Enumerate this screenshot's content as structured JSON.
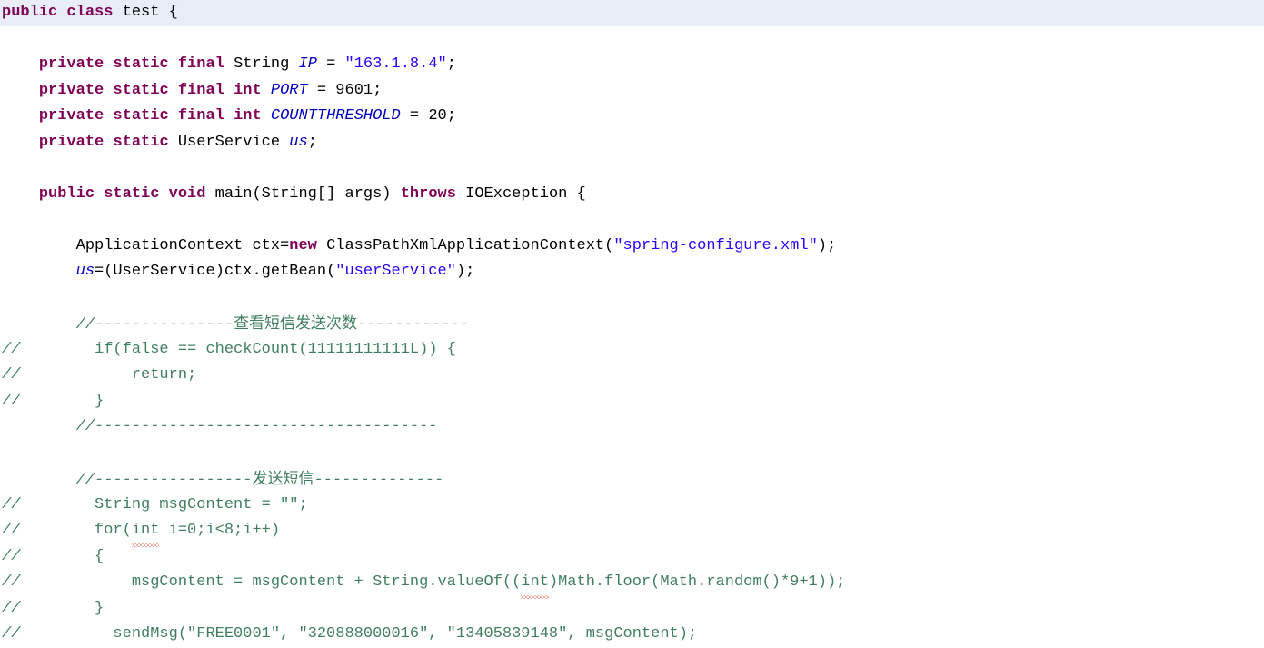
{
  "editor": {
    "language": "java",
    "class_name": "test",
    "colors": {
      "keyword": "#7f0055",
      "string": "#2a00ff",
      "field": "#0000c0",
      "comment": "#3f7f5f",
      "plain": "#000000",
      "highlight_line_bg": "#e8edf7",
      "error_squiggle": "#e05a3a",
      "background": "#ffffff"
    },
    "lines": [
      {
        "id": "line-class-decl",
        "highlighted": true,
        "text": "public class test {",
        "tokens": [
          {
            "t": "public",
            "k": "kw"
          },
          {
            "t": " ",
            "k": "plain"
          },
          {
            "t": "class",
            "k": "kw"
          },
          {
            "t": " test {",
            "k": "plain"
          }
        ]
      },
      {
        "id": "line-blank-1",
        "highlighted": false,
        "text": "",
        "tokens": []
      },
      {
        "id": "line-field-ip",
        "highlighted": false,
        "text": "    private static final String IP = \"163.1.8.4\";",
        "tokens": [
          {
            "t": "    ",
            "k": "plain"
          },
          {
            "t": "private",
            "k": "kw"
          },
          {
            "t": " ",
            "k": "plain"
          },
          {
            "t": "static",
            "k": "kw"
          },
          {
            "t": " ",
            "k": "plain"
          },
          {
            "t": "final",
            "k": "kw"
          },
          {
            "t": " String ",
            "k": "plain"
          },
          {
            "t": "IP",
            "k": "stfld"
          },
          {
            "t": " = ",
            "k": "plain"
          },
          {
            "t": "\"163.1.8.4\"",
            "k": "str"
          },
          {
            "t": ";",
            "k": "plain"
          }
        ]
      },
      {
        "id": "line-field-port",
        "highlighted": false,
        "text": "    private static final int PORT = 9601;",
        "tokens": [
          {
            "t": "    ",
            "k": "plain"
          },
          {
            "t": "private",
            "k": "kw"
          },
          {
            "t": " ",
            "k": "plain"
          },
          {
            "t": "static",
            "k": "kw"
          },
          {
            "t": " ",
            "k": "plain"
          },
          {
            "t": "final",
            "k": "kw"
          },
          {
            "t": " ",
            "k": "plain"
          },
          {
            "t": "int",
            "k": "kw"
          },
          {
            "t": " ",
            "k": "plain"
          },
          {
            "t": "PORT",
            "k": "stfld"
          },
          {
            "t": " = 9601;",
            "k": "plain"
          }
        ]
      },
      {
        "id": "line-field-countthreshold",
        "highlighted": false,
        "text": "    private static final int COUNTTHRESHOLD = 20;",
        "tokens": [
          {
            "t": "    ",
            "k": "plain"
          },
          {
            "t": "private",
            "k": "kw"
          },
          {
            "t": " ",
            "k": "plain"
          },
          {
            "t": "static",
            "k": "kw"
          },
          {
            "t": " ",
            "k": "plain"
          },
          {
            "t": "final",
            "k": "kw"
          },
          {
            "t": " ",
            "k": "plain"
          },
          {
            "t": "int",
            "k": "kw"
          },
          {
            "t": " ",
            "k": "plain"
          },
          {
            "t": "COUNTTHRESHOLD",
            "k": "stfld"
          },
          {
            "t": " = 20;",
            "k": "plain"
          }
        ]
      },
      {
        "id": "line-field-us",
        "highlighted": false,
        "text": "    private static UserService us;",
        "tokens": [
          {
            "t": "    ",
            "k": "plain"
          },
          {
            "t": "private",
            "k": "kw"
          },
          {
            "t": " ",
            "k": "plain"
          },
          {
            "t": "static",
            "k": "kw"
          },
          {
            "t": " UserService ",
            "k": "plain"
          },
          {
            "t": "us",
            "k": "fld"
          },
          {
            "t": ";",
            "k": "plain"
          }
        ]
      },
      {
        "id": "line-blank-2",
        "highlighted": false,
        "text": "",
        "tokens": []
      },
      {
        "id": "line-main-signature",
        "highlighted": false,
        "text": "    public static void main(String[] args) throws IOException {",
        "tokens": [
          {
            "t": "    ",
            "k": "plain"
          },
          {
            "t": "public",
            "k": "kw"
          },
          {
            "t": " ",
            "k": "plain"
          },
          {
            "t": "static",
            "k": "kw"
          },
          {
            "t": " ",
            "k": "plain"
          },
          {
            "t": "void",
            "k": "kw"
          },
          {
            "t": " main(String[] args) ",
            "k": "plain"
          },
          {
            "t": "throws",
            "k": "kw"
          },
          {
            "t": " IOException {",
            "k": "plain"
          }
        ]
      },
      {
        "id": "line-blank-3",
        "highlighted": false,
        "text": "",
        "tokens": []
      },
      {
        "id": "line-appctx",
        "highlighted": false,
        "text": "        ApplicationContext ctx=new ClassPathXmlApplicationContext(\"spring-configure.xml\");",
        "tokens": [
          {
            "t": "        ApplicationContext ctx=",
            "k": "plain"
          },
          {
            "t": "new",
            "k": "kw"
          },
          {
            "t": " ClassPathXmlApplicationContext(",
            "k": "plain"
          },
          {
            "t": "\"spring-configure.xml\"",
            "k": "str"
          },
          {
            "t": ");",
            "k": "plain"
          }
        ]
      },
      {
        "id": "line-getbean",
        "highlighted": false,
        "text": "        us=(UserService)ctx.getBean(\"userService\");",
        "tokens": [
          {
            "t": "        ",
            "k": "plain"
          },
          {
            "t": "us",
            "k": "fld"
          },
          {
            "t": "=(UserService)ctx.getBean(",
            "k": "plain"
          },
          {
            "t": "\"userService\"",
            "k": "str"
          },
          {
            "t": ");",
            "k": "plain"
          }
        ]
      },
      {
        "id": "line-blank-4",
        "highlighted": false,
        "text": "",
        "tokens": []
      },
      {
        "id": "line-comment-check-count",
        "highlighted": false,
        "text": "        //---------------查看短信发送次数------------",
        "tokens": [
          {
            "t": "        ",
            "k": "plain"
          },
          {
            "t": "//---------------",
            "k": "cmt-i"
          },
          {
            "t": "查看短信发送次数",
            "k": "cmt-cn"
          },
          {
            "t": "------------",
            "k": "cmt-i"
          }
        ]
      },
      {
        "id": "line-commented-if",
        "highlighted": false,
        "text": "//        if(false == checkCount(11111111111L)) {",
        "tokens": [
          {
            "t": "//",
            "k": "slash"
          },
          {
            "t": "        if(false == checkCount(11111111111L)) {",
            "k": "cmt"
          }
        ]
      },
      {
        "id": "line-commented-return",
        "highlighted": false,
        "text": "//            return;",
        "tokens": [
          {
            "t": "//",
            "k": "slash"
          },
          {
            "t": "            return;",
            "k": "cmt"
          }
        ]
      },
      {
        "id": "line-commented-closebrace",
        "highlighted": false,
        "text": "//        }",
        "tokens": [
          {
            "t": "//",
            "k": "slash"
          },
          {
            "t": "        }",
            "k": "cmt"
          }
        ]
      },
      {
        "id": "line-comment-divider-1",
        "highlighted": false,
        "text": "        //-------------------------------------",
        "tokens": [
          {
            "t": "        ",
            "k": "plain"
          },
          {
            "t": "//-------------------------------------",
            "k": "cmt-i"
          }
        ]
      },
      {
        "id": "line-blank-5",
        "highlighted": false,
        "text": "",
        "tokens": []
      },
      {
        "id": "line-comment-send-msg",
        "highlighted": false,
        "text": "        //-----------------发送短信--------------",
        "tokens": [
          {
            "t": "        ",
            "k": "plain"
          },
          {
            "t": "//-----------------",
            "k": "cmt-i"
          },
          {
            "t": "发送短信",
            "k": "cmt-cn"
          },
          {
            "t": "--------------",
            "k": "cmt-i"
          }
        ]
      },
      {
        "id": "line-commented-msgcontent-decl",
        "highlighted": false,
        "text": "//        String msgContent = \"\";",
        "tokens": [
          {
            "t": "//",
            "k": "slash"
          },
          {
            "t": "        String msgContent = \"\";",
            "k": "cmt"
          }
        ]
      },
      {
        "id": "line-commented-for",
        "highlighted": false,
        "text": "//        for(int i=0;i<8;i++)",
        "tokens": [
          {
            "t": "//",
            "k": "slash"
          },
          {
            "t": "        for(",
            "k": "cmt"
          },
          {
            "t": "int",
            "k": "cmt",
            "squiggle": true
          },
          {
            "t": " i=0;i<8;i++)",
            "k": "cmt"
          }
        ]
      },
      {
        "id": "line-commented-openbrace",
        "highlighted": false,
        "text": "//        {",
        "tokens": [
          {
            "t": "//",
            "k": "slash"
          },
          {
            "t": "        {",
            "k": "cmt"
          }
        ]
      },
      {
        "id": "line-commented-msgcontent-assign",
        "highlighted": false,
        "text": "//            msgContent = msgContent + String.valueOf((int)Math.floor(Math.random()*9+1));",
        "tokens": [
          {
            "t": "//",
            "k": "slash"
          },
          {
            "t": "            msgContent = msgContent + String.valueOf((",
            "k": "cmt"
          },
          {
            "t": "int",
            "k": "cmt",
            "squiggle": true
          },
          {
            "t": ")Math.floor(Math.random()*9+1));",
            "k": "cmt"
          }
        ]
      },
      {
        "id": "line-commented-closebrace-2",
        "highlighted": false,
        "text": "//        }",
        "tokens": [
          {
            "t": "//",
            "k": "slash"
          },
          {
            "t": "        }",
            "k": "cmt"
          }
        ]
      },
      {
        "id": "line-commented-sendmsg",
        "highlighted": false,
        "text": "//          sendMsg(\"FREE0001\", \"320888000016\", \"13405839148\", msgContent);",
        "tokens": [
          {
            "t": "//",
            "k": "slash"
          },
          {
            "t": "          sendMsg(\"FREE0001\", \"320888000016\", \"13405839148\", msgContent);",
            "k": "cmt"
          }
        ]
      }
    ]
  }
}
